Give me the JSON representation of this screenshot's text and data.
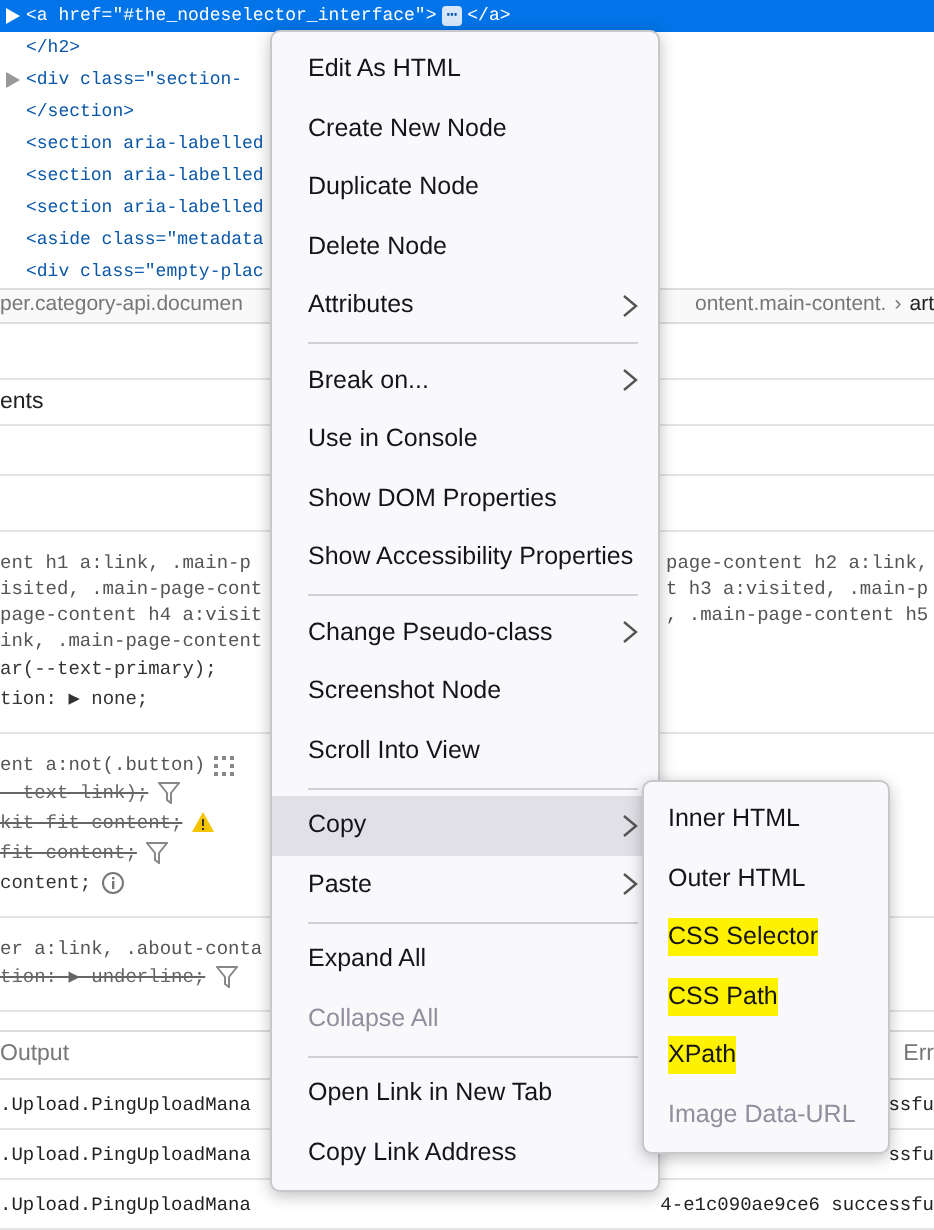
{
  "markup": [
    {
      "text": "<a href=\"#the_nodeselector_interface\">",
      "selected": true,
      "twisty": true,
      "collapsed_badge": "⋯",
      "closing": "</a>"
    },
    {
      "text": "</h2>",
      "selected": false,
      "twisty": false
    },
    {
      "text": "<div class=\"section-",
      "selected": false,
      "twisty": true
    },
    {
      "text": "</section>",
      "selected": false,
      "twisty": false
    },
    {
      "text": "<section aria-labelled",
      "selected": false,
      "twisty": false
    },
    {
      "text": "<section aria-labelled",
      "selected": false,
      "twisty": false
    },
    {
      "text": "<section aria-labelled",
      "selected": false,
      "twisty": false
    },
    {
      "text": "<aside class=\"metadata",
      "selected": false,
      "twisty": false
    },
    {
      "text": "<div class=\"empty-plac",
      "selected": false,
      "twisty": false
    }
  ],
  "breadcrumb": {
    "left": "per.category-api.documen",
    "right": "ontent.main-content.",
    "separator": "›",
    "current": "art"
  },
  "panel_tab": "ents",
  "rules": [
    {
      "selector_lines": [
        {
          "left": "ent h1 a:link, .main-p",
          "right": "page-content h2 a:link,"
        },
        {
          "left": "isited, .main-page-cont",
          "right": "t h3 a:visited, .main-p"
        },
        {
          "left": "page-content h4 a:visit",
          "right": ", .main-page-content h5"
        },
        {
          "left": "ink, .main-page-content"
        }
      ],
      "properties": [
        {
          "text": "ar(--text-primary);",
          "overridden": false
        },
        {
          "text": "tion: ▶ none;",
          "overridden": false
        }
      ]
    },
    {
      "selector_lines": [
        {
          "left": "ent a:not(.button)",
          "dots_icon": true
        }
      ],
      "properties": [
        {
          "text": "--text-link);",
          "overridden": true,
          "filter_icon": true
        },
        {
          "text": "kit fit content;",
          "overridden": true,
          "warning_icon": true
        },
        {
          "text": "fit content;",
          "overridden": true,
          "filter_icon": true
        },
        {
          "text": "content;",
          "overridden": false,
          "info_icon": true
        }
      ]
    },
    {
      "selector_lines": [
        {
          "left": "er a:link, .about-conta"
        }
      ],
      "properties": [
        {
          "text": "tion: ▶ underline;",
          "overridden": true,
          "filter_icon": true
        }
      ]
    }
  ],
  "console": {
    "tab": "Output",
    "right_tab": "Err",
    "rows": [
      {
        "left": ".Upload.PingUploadMana",
        "right": "ssfu"
      },
      {
        "left": ".Upload.PingUploadMana",
        "right": "ssfu"
      },
      {
        "left": ".Upload.PingUploadMana",
        "right": "4-e1c090ae9ce6 successfu"
      }
    ]
  },
  "context_menu": {
    "items": [
      {
        "kind": "item",
        "label": "Edit As HTML",
        "submenu": false,
        "selected": false,
        "disabled": false
      },
      {
        "kind": "item",
        "label": "Create New Node",
        "submenu": false,
        "selected": false,
        "disabled": false
      },
      {
        "kind": "item",
        "label": "Duplicate Node",
        "submenu": false,
        "selected": false,
        "disabled": false
      },
      {
        "kind": "item",
        "label": "Delete Node",
        "submenu": false,
        "selected": false,
        "disabled": false
      },
      {
        "kind": "item",
        "label": "Attributes",
        "submenu": true,
        "selected": false,
        "disabled": false
      },
      {
        "kind": "separator"
      },
      {
        "kind": "item",
        "label": "Break on...",
        "submenu": true,
        "selected": false,
        "disabled": false
      },
      {
        "kind": "item",
        "label": "Use in Console",
        "submenu": false,
        "selected": false,
        "disabled": false
      },
      {
        "kind": "item",
        "label": "Show DOM Properties",
        "submenu": false,
        "selected": false,
        "disabled": false
      },
      {
        "kind": "item",
        "label": "Show Accessibility Properties",
        "submenu": false,
        "selected": false,
        "disabled": false
      },
      {
        "kind": "separator"
      },
      {
        "kind": "item",
        "label": "Change Pseudo-class",
        "submenu": true,
        "selected": false,
        "disabled": false
      },
      {
        "kind": "item",
        "label": "Screenshot Node",
        "submenu": false,
        "selected": false,
        "disabled": false
      },
      {
        "kind": "item",
        "label": "Scroll Into View",
        "submenu": false,
        "selected": false,
        "disabled": false
      },
      {
        "kind": "separator"
      },
      {
        "kind": "item",
        "label": "Copy",
        "submenu": true,
        "selected": true,
        "disabled": false
      },
      {
        "kind": "item",
        "label": "Paste",
        "submenu": true,
        "selected": false,
        "disabled": false
      },
      {
        "kind": "separator"
      },
      {
        "kind": "item",
        "label": "Expand All",
        "submenu": false,
        "selected": false,
        "disabled": false
      },
      {
        "kind": "item",
        "label": "Collapse All",
        "submenu": false,
        "selected": false,
        "disabled": true
      },
      {
        "kind": "separator"
      },
      {
        "kind": "item",
        "label": "Open Link in New Tab",
        "submenu": false,
        "selected": false,
        "disabled": false
      },
      {
        "kind": "item",
        "label": "Copy Link Address",
        "submenu": false,
        "selected": false,
        "disabled": false
      }
    ]
  },
  "copy_submenu": {
    "items": [
      {
        "label": "Inner HTML",
        "highlighted": false,
        "disabled": false,
        "selected": false
      },
      {
        "label": "Outer HTML",
        "highlighted": false,
        "disabled": false,
        "selected": false
      },
      {
        "label": "CSS Selector",
        "highlighted": true,
        "disabled": false,
        "selected": false
      },
      {
        "label": "CSS Path",
        "highlighted": true,
        "disabled": false,
        "selected": false
      },
      {
        "label": "XPath",
        "highlighted": true,
        "disabled": false,
        "selected": false
      },
      {
        "label": "Image Data-URL",
        "highlighted": false,
        "disabled": true,
        "selected": false
      }
    ]
  }
}
